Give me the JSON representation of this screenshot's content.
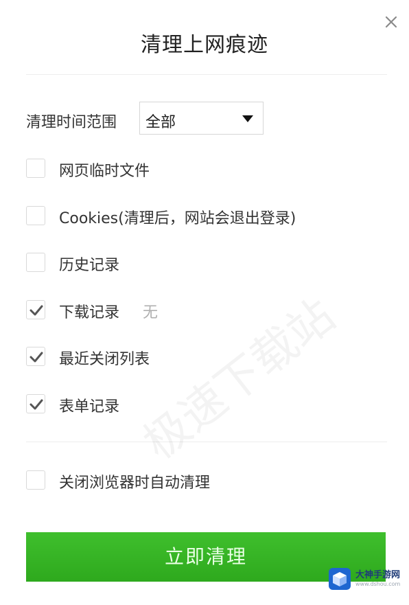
{
  "dialog": {
    "title": "清理上网痕迹",
    "close_icon": "close-icon"
  },
  "range": {
    "label": "清理时间范围",
    "selected": "全部"
  },
  "options": [
    {
      "label": "网页临时文件",
      "checked": false
    },
    {
      "label": "Cookies(清理后，网站会退出登录)",
      "checked": false
    },
    {
      "label": "历史记录",
      "checked": false
    },
    {
      "label": "下载记录",
      "checked": true,
      "extra": "无"
    },
    {
      "label": "最近关闭列表",
      "checked": true
    },
    {
      "label": "表单记录",
      "checked": true
    }
  ],
  "auto_clean": {
    "label": "关闭浏览器时自动清理",
    "checked": false
  },
  "action": {
    "label": "立即清理"
  },
  "watermark": {
    "text": "极速下载站"
  },
  "logo": {
    "name": "大神手游网",
    "url": "www.dshou.com"
  },
  "colors": {
    "accent": "#35b425",
    "check": "#555555"
  }
}
